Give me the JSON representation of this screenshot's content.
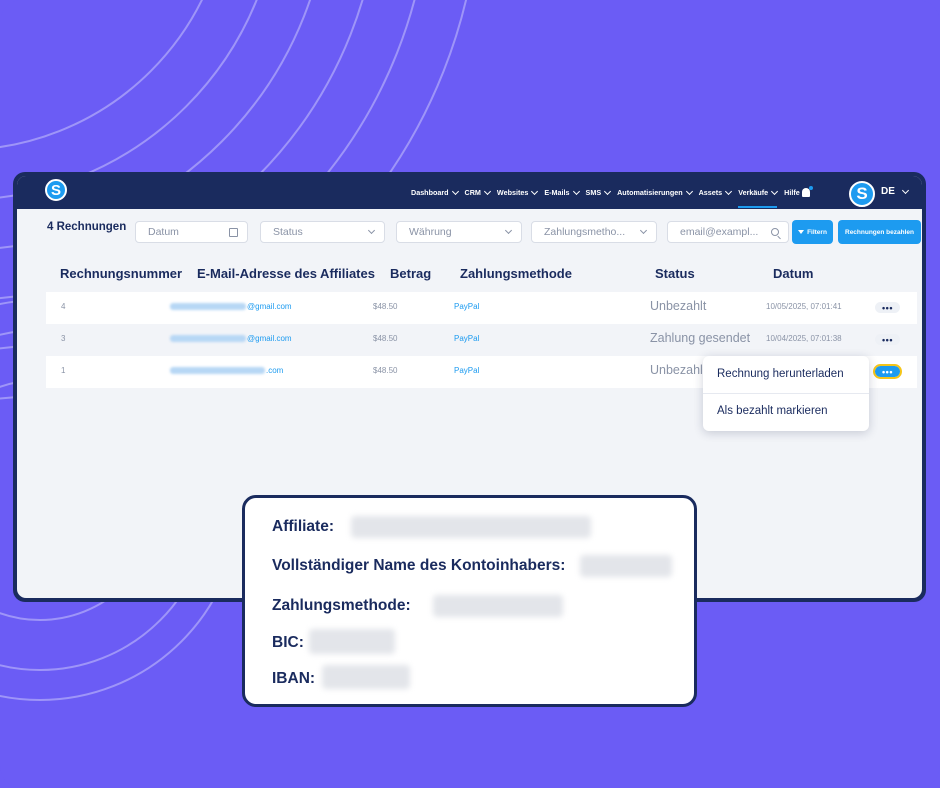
{
  "brand": {
    "logo_letter": "S"
  },
  "nav": {
    "items": [
      {
        "label": "Dashboard"
      },
      {
        "label": "CRM"
      },
      {
        "label": "Websites"
      },
      {
        "label": "E-Mails"
      },
      {
        "label": "SMS"
      },
      {
        "label": "Automatisierungen"
      },
      {
        "label": "Assets"
      },
      {
        "label": "Verkäufe"
      }
    ],
    "help_label": "Hilfe",
    "avatar_letter": "S",
    "language": "DE"
  },
  "toolbar": {
    "count_label": "4 Rechnungen",
    "date_placeholder": "Datum",
    "status_placeholder": "Status",
    "currency_placeholder": "Währung",
    "payment_placeholder": "Zahlungsmetho...",
    "email_placeholder": "email@exampl...",
    "filter_label": "Filtern",
    "pay_label": "Rechnungen bezahlen"
  },
  "table": {
    "headers": [
      "Rechnungsnummer",
      "E-Mail-Adresse des Affiliates",
      "Betrag",
      "Zahlungsmethode",
      "Status",
      "Datum"
    ],
    "rows": [
      {
        "number": "4",
        "email_suffix": "@gmail.com",
        "amount": "$48.50",
        "method": "PayPal",
        "status": "Unbezahlt",
        "date": "10/05/2025, 07:01:41"
      },
      {
        "number": "3",
        "email_suffix": "@gmail.com",
        "amount": "$48.50",
        "method": "PayPal",
        "status": "Zahlung gesendet",
        "date": "10/04/2025, 07:01:38"
      },
      {
        "number": "1",
        "email_suffix": ".com",
        "amount": "$48.50",
        "method": "PayPal",
        "status": "Unbezahlt",
        "date": ""
      }
    ],
    "more_label": "•••"
  },
  "menu": {
    "download": "Rechnung herunterladen",
    "mark_paid": "Als bezahlt markieren"
  },
  "details": {
    "affiliate": "Affiliate:",
    "holder": "Vollständiger Name des Kontoinhabers:",
    "method": "Zahlungsmethode:",
    "bic": "BIC:",
    "iban": "IBAN:"
  }
}
